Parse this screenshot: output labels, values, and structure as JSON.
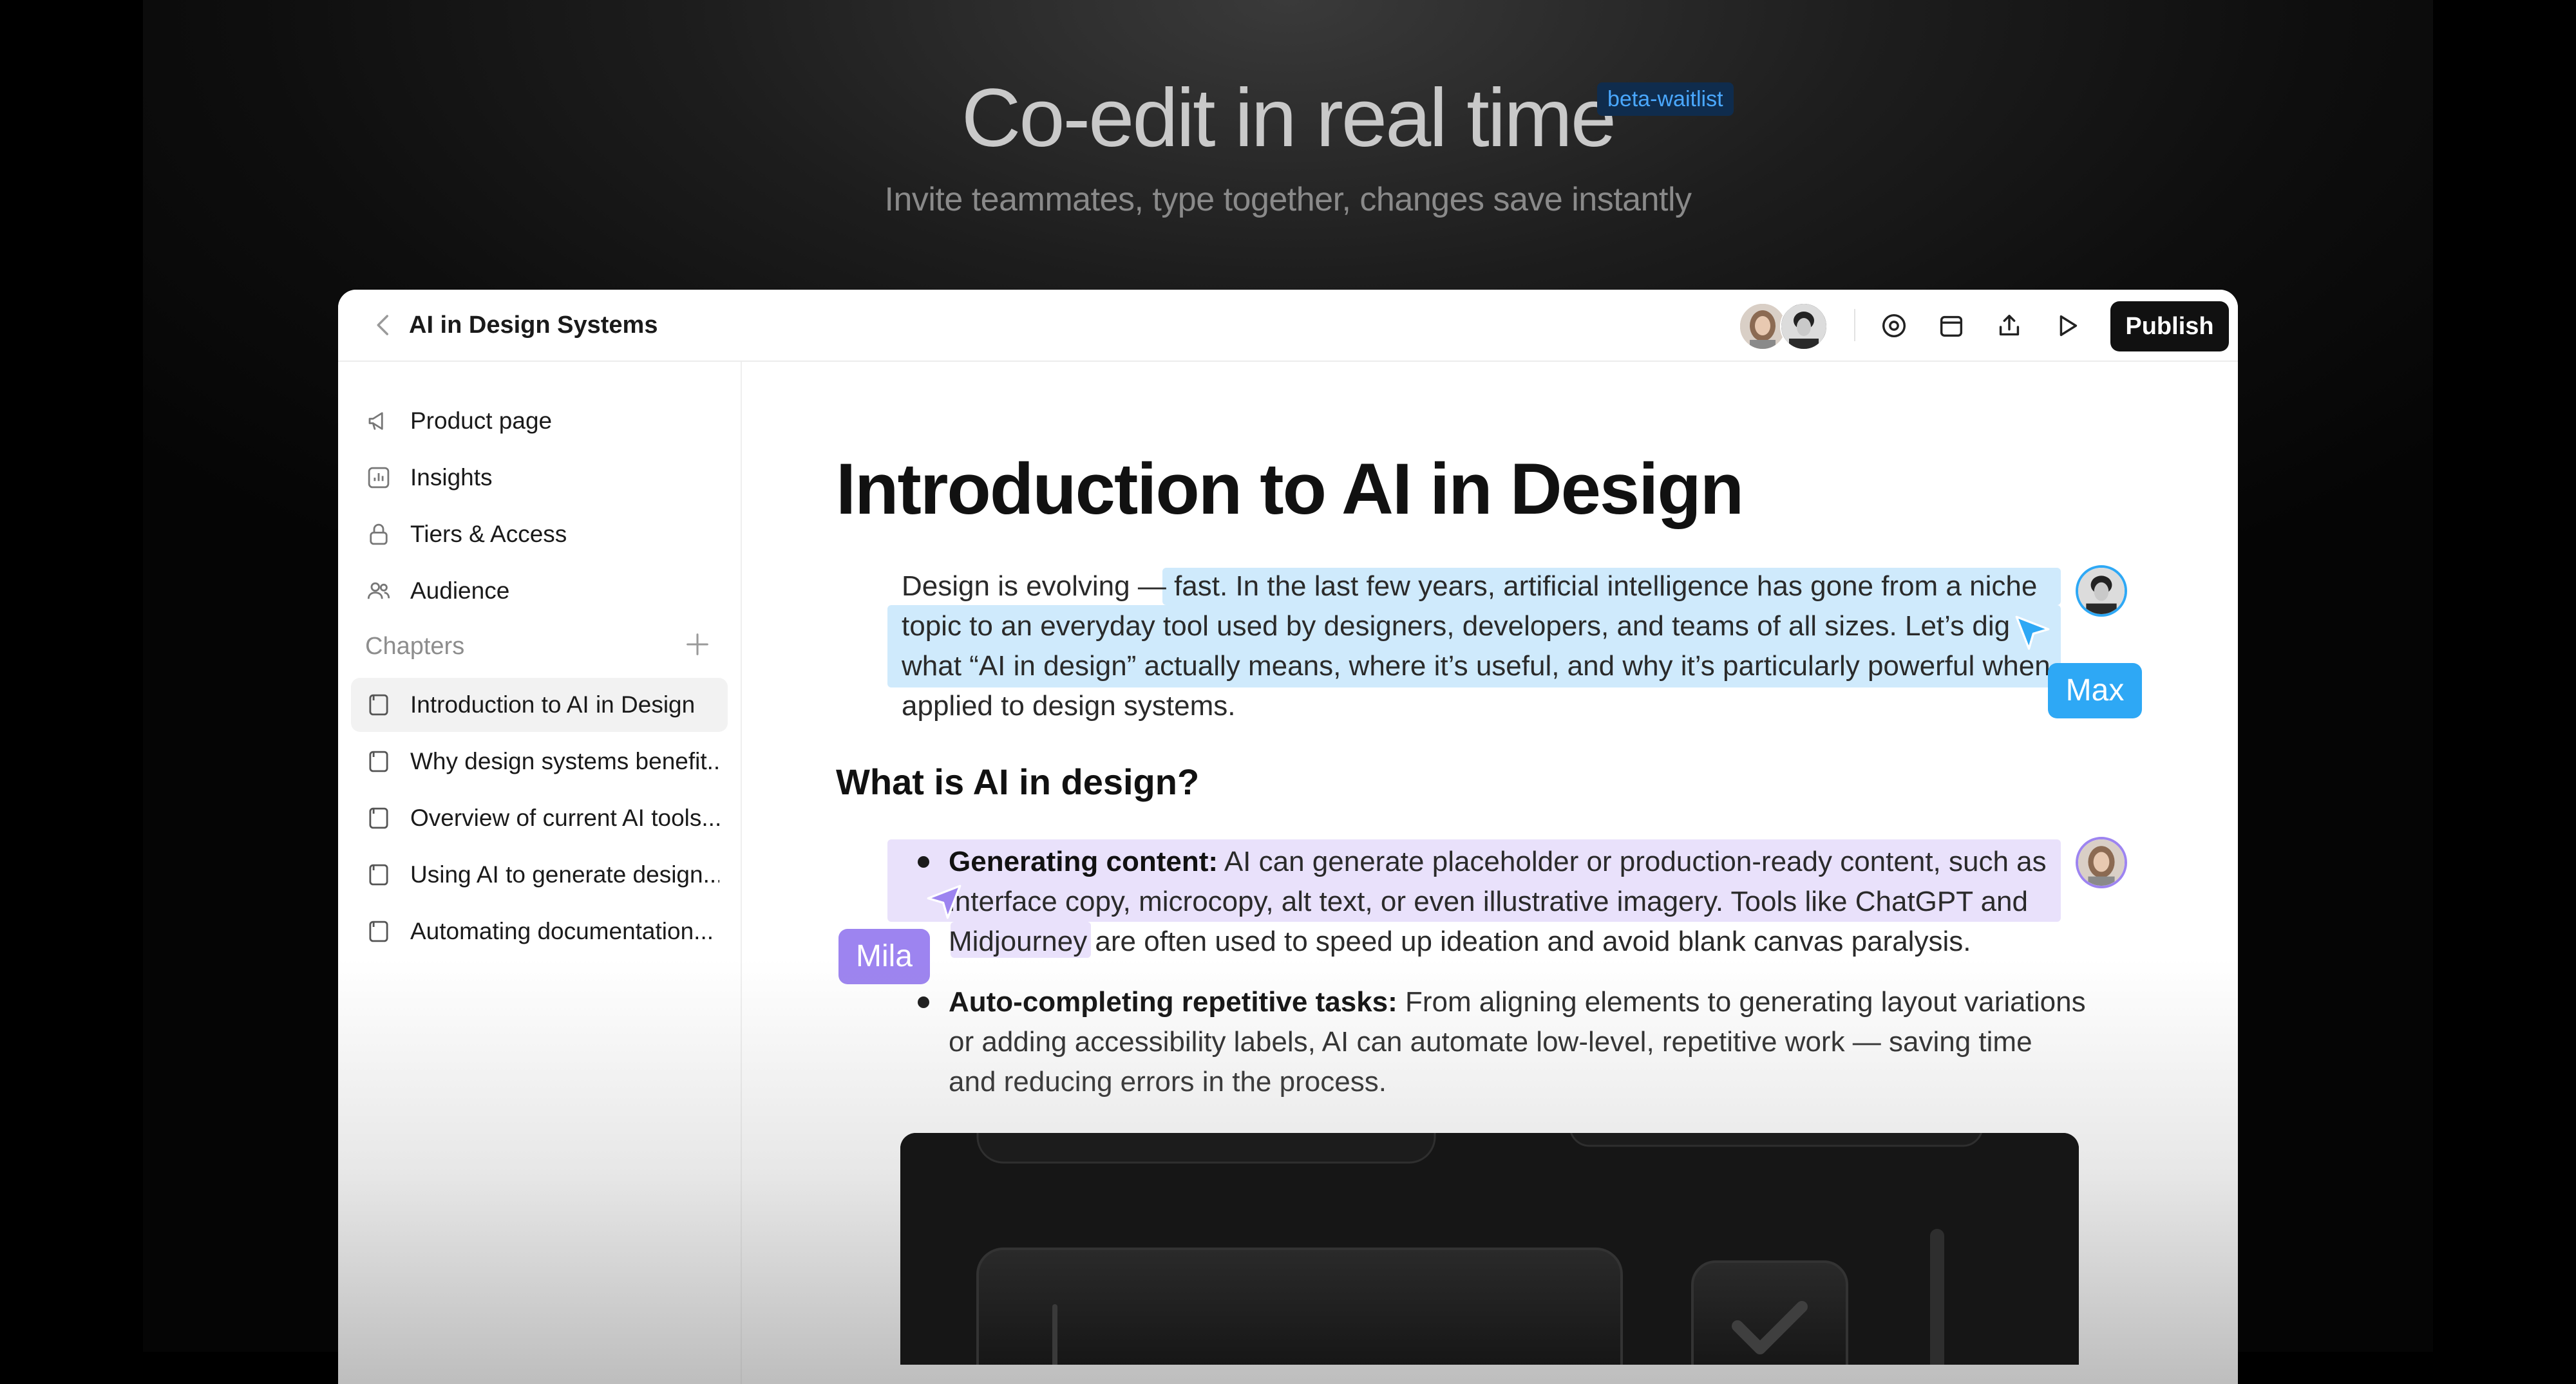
{
  "hero": {
    "title": "Co-edit in real time",
    "badge": "beta-waitlist",
    "subtitle": "Invite teammates, type together, changes save instantly"
  },
  "topbar": {
    "doc_title": "AI in Design Systems",
    "publish_label": "Publish",
    "icons": [
      "back-chevron-icon",
      "settings-icon",
      "calendar-icon",
      "share-icon",
      "play-icon"
    ]
  },
  "sidebar": {
    "nav": [
      {
        "label": "Product page",
        "icon": "megaphone-icon"
      },
      {
        "label": "Insights",
        "icon": "bar-chart-icon"
      },
      {
        "label": "Tiers & Access",
        "icon": "lock-icon"
      },
      {
        "label": "Audience",
        "icon": "users-icon"
      }
    ],
    "chapters_label": "Chapters",
    "chapters": [
      {
        "label": "Introduction to AI in Design",
        "active": true
      },
      {
        "label": "Why design systems benefit...",
        "active": false
      },
      {
        "label": "Overview of current AI tools...",
        "active": false
      },
      {
        "label": "Using AI to generate design...",
        "active": false
      },
      {
        "label": "Automating documentation...",
        "active": false
      }
    ]
  },
  "document": {
    "title": "Introduction to AI in Design",
    "intro_lines": [
      "Design is evolving — fast. In the last few years, artificial intelligence has gone from a niche",
      "topic to an everyday tool used by designers, developers, and teams of all sizes. Let’s dig",
      "what “AI in design” actually means, where it’s useful, and why it’s particularly powerful when",
      "applied to design systems."
    ],
    "section_heading": "What is AI in design?",
    "bullets": [
      {
        "bold": "Generating content:",
        "lines": [
          " AI can generate placeholder or production-ready content, such as",
          "interface copy, microcopy, alt text, or even illustrative imagery. Tools like ChatGPT and",
          "Midjourney are often used to speed up ideation and avoid blank canvas paralysis."
        ]
      },
      {
        "bold": "Auto-completing repetitive tasks:",
        "lines": [
          " From aligning elements to generating layout variations",
          "or adding accessibility labels, AI can automate low-level, repetitive work — saving time",
          "and reducing errors in the process."
        ]
      }
    ]
  },
  "collaborators": [
    {
      "name": "Max",
      "color": "#2ea8f5",
      "highlight": "#cfeafc"
    },
    {
      "name": "Mila",
      "color": "#9d84f0",
      "highlight": "#e9e1fb"
    }
  ]
}
